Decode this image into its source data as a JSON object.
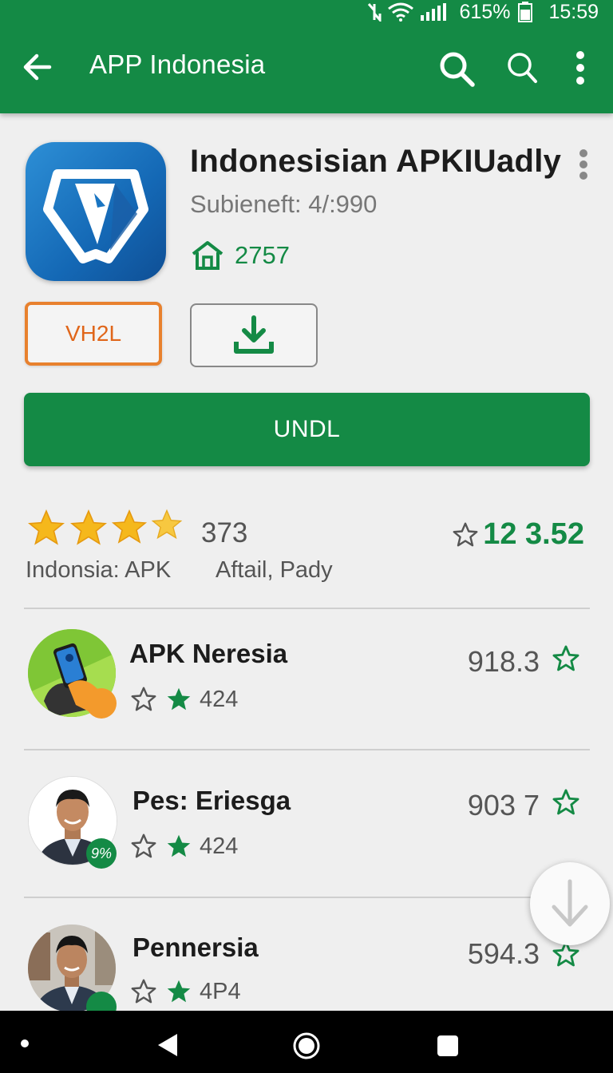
{
  "status_bar": {
    "battery": "615%",
    "time": "15:59"
  },
  "app_bar": {
    "title": "APP Indonesia"
  },
  "app": {
    "name": "Indonesisian  APKIUadly",
    "subtitle": "Subieneft: 4/:990",
    "count": "2757",
    "outline_button_label": "VH2L",
    "primary_button_label": "UNDL"
  },
  "rating": {
    "stars": 4,
    "count": "373",
    "left_label": "Indonsia: APK",
    "mid_label": "Aftail, Pady",
    "right_value": "12 3.52"
  },
  "list": [
    {
      "title": "APK Neresia",
      "sub_value": "424",
      "value": "918.3"
    },
    {
      "title": "Pes: Eriesga",
      "sub_value": "424",
      "value": "903 7",
      "badge": "9%"
    },
    {
      "title": "Pennersia",
      "sub_value": "4P4",
      "value": "594.3"
    }
  ],
  "colors": {
    "primary": "#148a45",
    "accent_orange": "#e8812e",
    "star_yellow": "#f5b81c"
  }
}
